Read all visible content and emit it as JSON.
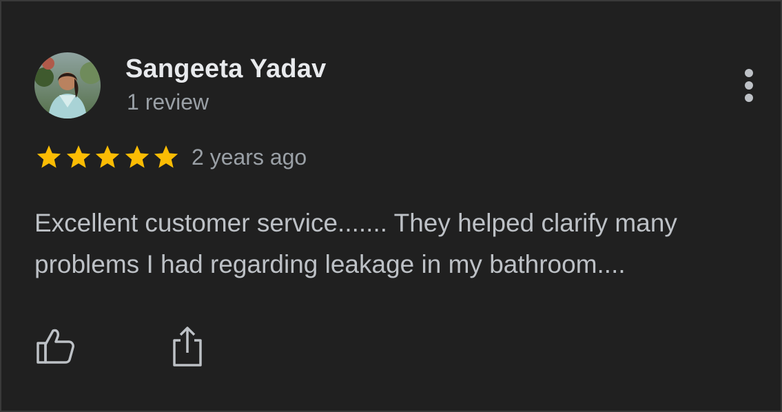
{
  "reviewer": {
    "name": "Sangeeta Yadav",
    "review_count": "1 review",
    "avatar_icon": "profile-photo"
  },
  "rating": {
    "stars": 5,
    "max_stars": 5,
    "star_color": "#fbbc04"
  },
  "time_ago": "2 years ago",
  "review_text": "Excellent customer service....... They helped clarify many problems I had regarding leakage in my bathroom....",
  "actions": {
    "more_icon": "more-vert-icon",
    "like_icon": "thumb-up-icon",
    "share_icon": "share-icon"
  },
  "colors": {
    "background": "#202020",
    "primary_text": "#e8eaed",
    "secondary_text": "#9aa0a6",
    "body_text": "#bdc1c6"
  }
}
